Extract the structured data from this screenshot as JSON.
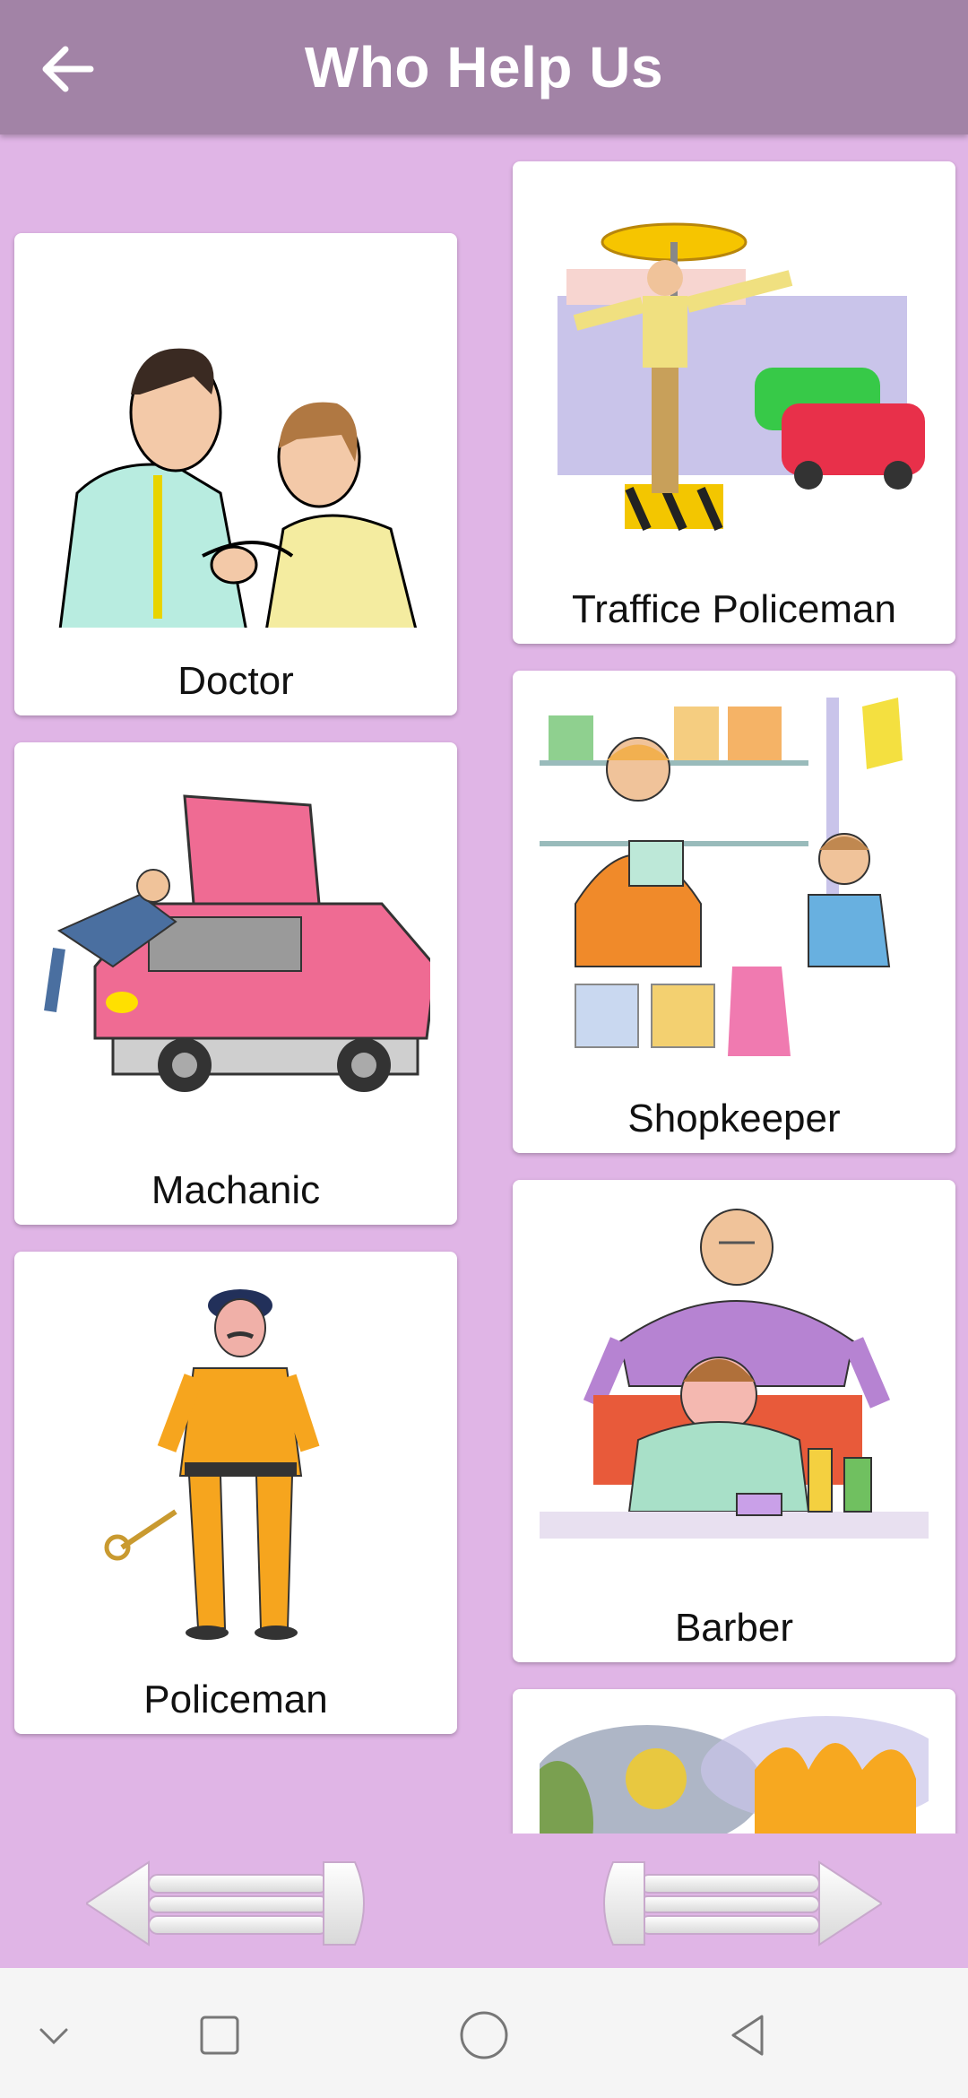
{
  "app": {
    "title": "Who Help Us"
  },
  "icons": {
    "back": "back-arrow-icon",
    "prev": "previous-arrow-icon",
    "next": "next-arrow-icon"
  },
  "cards": [
    {
      "label": "Doctor"
    },
    {
      "label": "Traffice Policeman"
    },
    {
      "label": "Machanic"
    },
    {
      "label": "Shopkeeper"
    },
    {
      "label": "Policeman"
    },
    {
      "label": "Barber"
    },
    {
      "label": ""
    }
  ],
  "colors": {
    "background": "#e0b5e6",
    "appbar": "#a283a6",
    "card": "#ffffff"
  }
}
